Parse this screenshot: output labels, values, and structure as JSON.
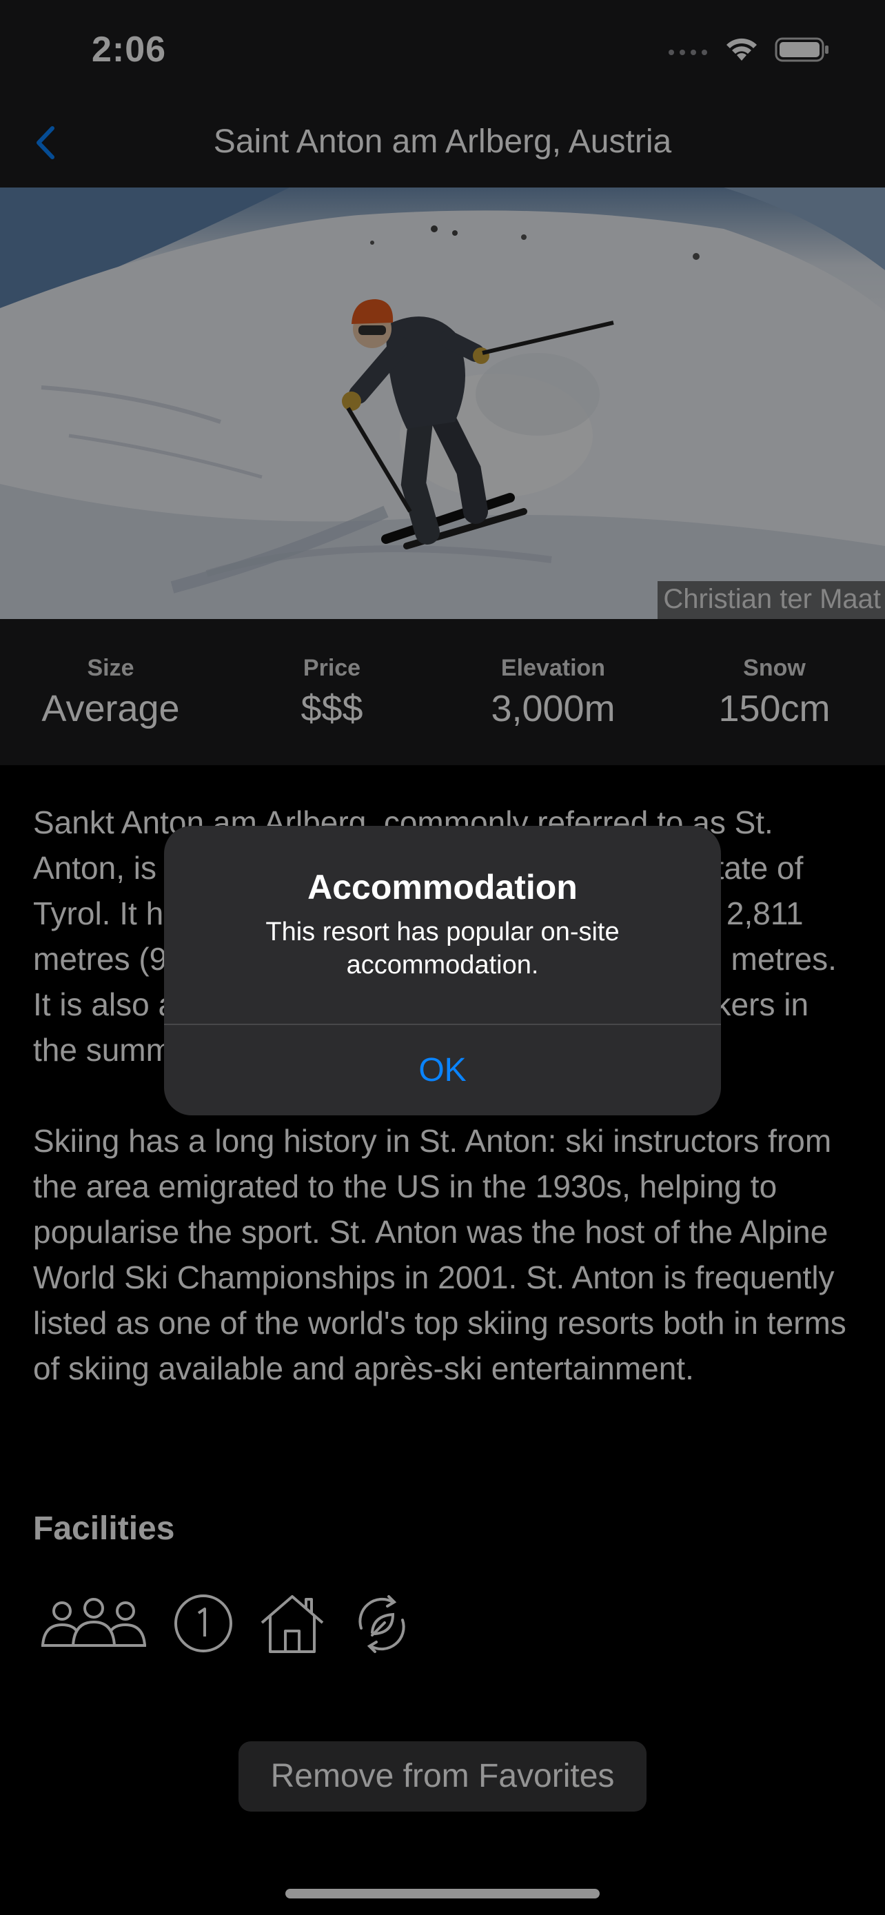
{
  "status_bar": {
    "time": "2:06"
  },
  "nav": {
    "title": "Saint Anton am Arlberg, Austria"
  },
  "hero": {
    "photo_credit": "Christian ter Maat"
  },
  "stats": [
    {
      "label": "Size",
      "value": "Average"
    },
    {
      "label": "Price",
      "value": "$$$"
    },
    {
      "label": "Elevation",
      "value": "3,000m"
    },
    {
      "label": "Snow",
      "value": "150cm"
    }
  ],
  "content": {
    "paragraph1": "Sankt Anton am Arlberg, commonly referred to as St. Anton, is a village and ski resort in the Austrian state of Tyrol. It has the world's highest aerial tramway of 2,811 metres (9,222 ft), yielding a vertical drop of 1,507 metres. It is also a popular destination for hikers and trekkers in the summer.",
    "paragraph2": "Skiing has a long history in St. Anton: ski instructors from the area emigrated to the US in the 1930s, helping to popularise the sport. St. Anton was the host of the Alpine World Ski Championships in 2001. St. Anton is frequently listed as one of the world's top skiing resorts both in terms of skiing available and après-ski entertainment.",
    "facilities_title": "Facilities",
    "facilities": [
      "people-icon",
      "number-one-icon",
      "house-icon",
      "recycle-leaf-icon"
    ]
  },
  "favorites_button": "Remove from Favorites",
  "alert": {
    "title": "Accommodation",
    "message": "This resort has popular on-site accommodation.",
    "ok_label": "OK"
  },
  "colors": {
    "accent": "#0a84ff",
    "bar_background": "#1c1c1e",
    "alert_background": "#2c2c2e"
  }
}
